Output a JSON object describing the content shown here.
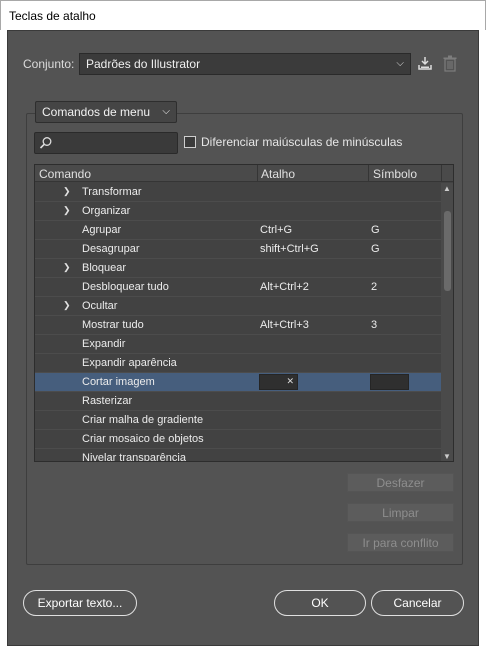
{
  "window": {
    "title": "Teclas de atalho"
  },
  "set": {
    "label": "Conjunto:",
    "value": "Padrões do Illustrator"
  },
  "icons": {
    "save_set": "save-set-icon",
    "delete_set": "trash-icon",
    "search": "search-icon"
  },
  "panel": {
    "dropdown_value": "Comandos de menu",
    "search_placeholder": "",
    "case_checkbox_label": "Diferenciar maiúsculas de minúsculas",
    "case_checked": false
  },
  "table": {
    "headers": {
      "command": "Comando",
      "shortcut": "Atalho",
      "symbol": "Símbolo"
    },
    "rows": [
      {
        "cmd": "Transformar",
        "shortcut": "",
        "symbol": "",
        "expandable": true
      },
      {
        "cmd": "Organizar",
        "shortcut": "",
        "symbol": "",
        "expandable": true
      },
      {
        "cmd": "Agrupar",
        "shortcut": "Ctrl+G",
        "symbol": "G",
        "expandable": false
      },
      {
        "cmd": "Desagrupar",
        "shortcut": "shift+Ctrl+G",
        "symbol": "G",
        "expandable": false
      },
      {
        "cmd": "Bloquear",
        "shortcut": "",
        "symbol": "",
        "expandable": true
      },
      {
        "cmd": "Desbloquear tudo",
        "shortcut": "Alt+Ctrl+2",
        "symbol": "2",
        "expandable": false
      },
      {
        "cmd": "Ocultar",
        "shortcut": "",
        "symbol": "",
        "expandable": true
      },
      {
        "cmd": "Mostrar tudo",
        "shortcut": "Alt+Ctrl+3",
        "symbol": "3",
        "expandable": false
      },
      {
        "cmd": "Expandir",
        "shortcut": "",
        "symbol": "",
        "expandable": false
      },
      {
        "cmd": "Expandir aparência",
        "shortcut": "",
        "symbol": "",
        "expandable": false
      },
      {
        "cmd": "Cortar imagem",
        "shortcut": "",
        "symbol": "",
        "expandable": false,
        "selected": true
      },
      {
        "cmd": "Rasterizar",
        "shortcut": "",
        "symbol": "",
        "expandable": false
      },
      {
        "cmd": "Criar malha de gradiente",
        "shortcut": "",
        "symbol": "",
        "expandable": false
      },
      {
        "cmd": "Criar mosaico de objetos",
        "shortcut": "",
        "symbol": "",
        "expandable": false
      },
      {
        "cmd": "Nivelar transparência",
        "shortcut": "",
        "symbol": "",
        "expandable": false
      }
    ]
  },
  "side_buttons": {
    "undo": "Desfazer",
    "clear": "Limpar",
    "goto_conflict": "Ir para conflito"
  },
  "footer": {
    "export": "Exportar texto...",
    "ok": "OK",
    "cancel": "Cancelar"
  }
}
